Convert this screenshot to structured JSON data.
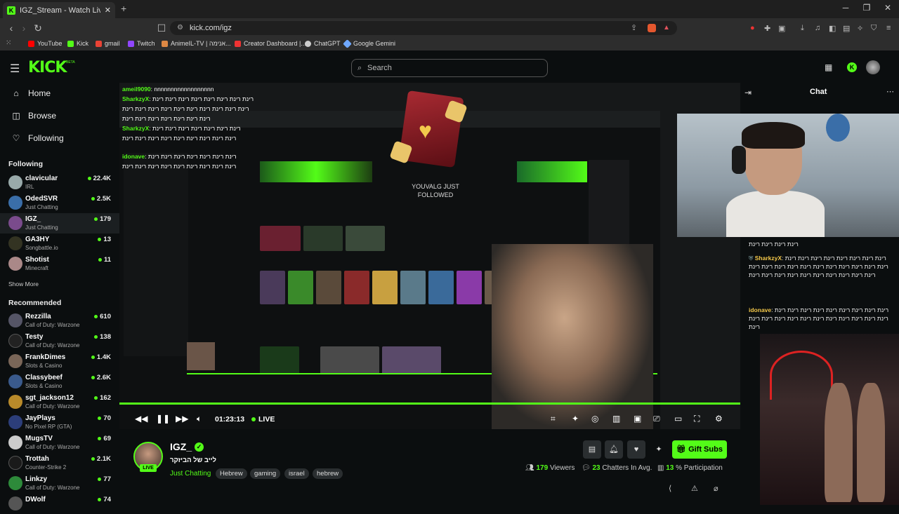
{
  "browser": {
    "tab_title": "IGZ_Stream - Watch Live on",
    "url": "kick.com/igz",
    "bookmarks": [
      "YouTube",
      "Kick",
      "gmail",
      "Twitch",
      "AnimeIL-TV | אנימה...",
      "Creator Dashboard |...",
      "ChatGPT",
      "Google Gemini"
    ]
  },
  "header": {
    "logo": "KICK",
    "beta": "BETA",
    "search_placeholder": "Search"
  },
  "sidebar": {
    "nav": [
      {
        "label": "Home",
        "icon": "home-icon"
      },
      {
        "label": "Browse",
        "icon": "browse-icon"
      },
      {
        "label": "Following",
        "icon": "heart-icon"
      }
    ],
    "following_title": "Following",
    "following": [
      {
        "name": "clavicular",
        "sub": "IRL",
        "viewers": "22.4K"
      },
      {
        "name": "OdedSVR",
        "sub": "Just Chatting",
        "viewers": "2.5K"
      },
      {
        "name": "IGZ_",
        "sub": "Just Chatting",
        "viewers": "179"
      },
      {
        "name": "GA3HY",
        "sub": "Songbattle.io",
        "viewers": "13"
      },
      {
        "name": "Shotist",
        "sub": "Minecraft",
        "viewers": "11"
      }
    ],
    "show_more": "Show More",
    "recommended_title": "Recommended",
    "recommended": [
      {
        "name": "Rezzilla",
        "sub": "Call of Duty: Warzone",
        "viewers": "610"
      },
      {
        "name": "Testy",
        "sub": "Call of Duty: Warzone",
        "viewers": "138"
      },
      {
        "name": "FrankDimes",
        "sub": "Slots & Casino",
        "viewers": "1.4K"
      },
      {
        "name": "Classybeef",
        "sub": "Slots & Casino",
        "viewers": "2.6K"
      },
      {
        "name": "sgt_jackson12",
        "sub": "Call of Duty: Warzone",
        "viewers": "162"
      },
      {
        "name": "JayPlays",
        "sub": "No Pixel RP (GTA)",
        "viewers": "70"
      },
      {
        "name": "MugsTV",
        "sub": "Call of Duty: Warzone",
        "viewers": "69"
      },
      {
        "name": "Trottah",
        "sub": "Counter-Strike 2",
        "viewers": "2.1K"
      },
      {
        "name": "Linkzy",
        "sub": "Call of Duty: Warzone",
        "viewers": "77"
      },
      {
        "name": "DWolf",
        "sub": "",
        "viewers": "74"
      }
    ]
  },
  "video": {
    "overlay_lines": [
      {
        "user": "ameil9090",
        "text": ": nnnnnnnnnnnnnnnnnn"
      },
      {
        "user": "SharkzyX",
        "text": ": רינת רינת רינת רינת רינת רינת רינת רינת"
      },
      {
        "user": "",
        "text": "רינת רינת רינת רינת רינת רינת רינת רינת רינת רינת"
      },
      {
        "user": "",
        "text": "רינת רינת רינת רינת רינת רינת רינת"
      },
      {
        "user": "SharkzyX",
        "text": ": רינת רינת רינת רינת רינת רינת רינת"
      },
      {
        "user": "",
        "text": "רינת רינת רינת רינת רינת רינת רינת רינת רינת"
      },
      {
        "user": "idonave",
        "text": ": רינת רינת רינת רינת רינת רינת רינת"
      },
      {
        "user": "",
        "text": "רינת רינת רינת רינת רינת רינת רינת רינת רינת"
      }
    ],
    "follow_alert": "YOUVALG JUST FOLLOWED",
    "timecode": "01:23:13",
    "live_label": "LIVE"
  },
  "chat": {
    "title": "Chat",
    "messages": [
      {
        "user": "",
        "text": "רינת רינת רינת רינת"
      },
      {
        "user": "SharkzyX",
        "text": ": רינת רינת רינת רינת רינת רינת רינת רינת רינת רינת רינת רינת רינת רינת רינת רינת רינת רינת רינת רינת רינת רינת רינת רינת רינת רינת רינת רינת רינת"
      },
      {
        "user": "idonave",
        "text": ": רינת רינת רינת רינת רינת רינת רינת רינת רינת רינת רינת רינת רינת רינת רינת רינת רינת רינת רינת רינת רינת"
      }
    ]
  },
  "stream": {
    "channel": "IGZ_",
    "title": "לייב של הביזקר",
    "category": "Just Chatting",
    "tags": [
      "Hebrew",
      "gaming",
      "israel",
      "hebrew"
    ],
    "live_badge": "LIVE",
    "gift_label": "Gift Subs",
    "viewers": "179",
    "viewers_label": "Viewers",
    "chatters": "23",
    "chatters_label": "Chatters In Avg.",
    "participation": "13",
    "participation_label": "% Participation"
  }
}
